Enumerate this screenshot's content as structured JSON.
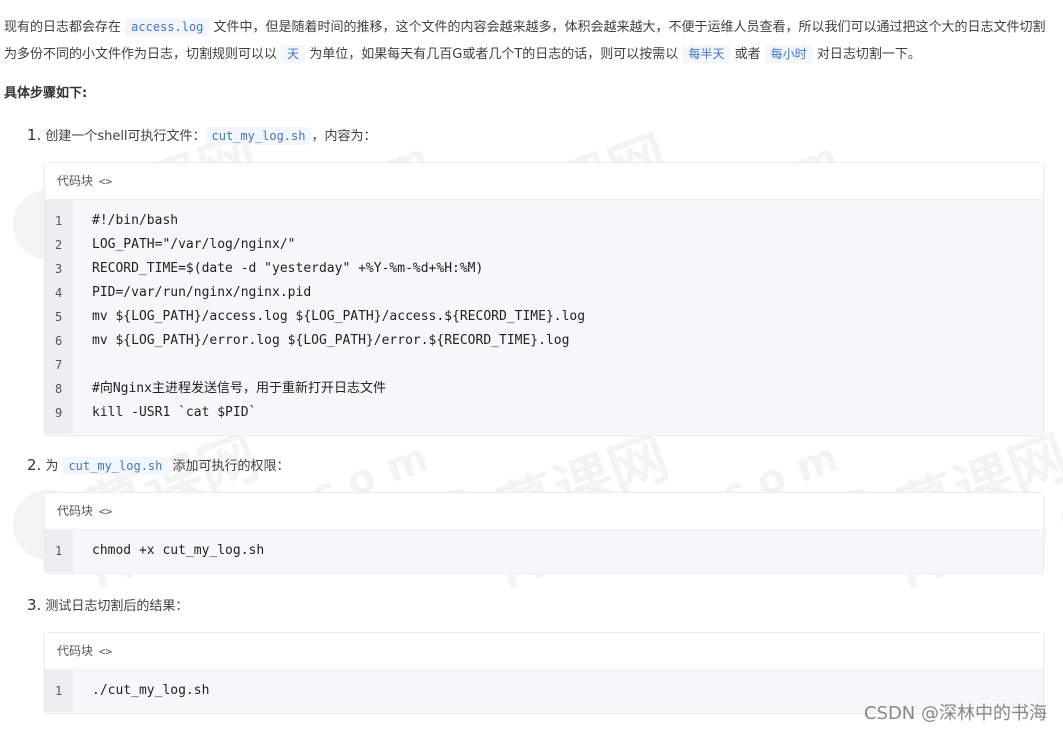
{
  "intro": {
    "seg1": "现有的日志都会存在 ",
    "code1": "access.log",
    "seg2": " 文件中，但是随着时间的推移，这个文件的内容会越来越多，体积会越来越大，不便于运维人员查看，所以我们可以通过把这个大的日志文件切割为多份不同的小文件作为日志，切割规则可以以 ",
    "code2": "天",
    "seg3": " 为单位，如果每天有几百G或者几个T的日志的话，则可以按需以 ",
    "code3": "每半天",
    "seg4": " 或者 ",
    "code4": "每小时",
    "seg5": " 对日志切割一下。"
  },
  "steps_heading": "具体步骤如下:",
  "step1": {
    "num": "1.",
    "text_before": "创建一个shell可执行文件：",
    "code": "cut_my_log.sh",
    "text_after": "，内容为："
  },
  "step2": {
    "num": "2.",
    "text_before": "为 ",
    "code": "cut_my_log.sh",
    "text_after": " 添加可执行的权限："
  },
  "step3": {
    "num": "3.",
    "text": "测试日志切割后的结果："
  },
  "code_header": {
    "label": "代码块",
    "tag": "<>"
  },
  "code_block_1": {
    "line_numbers": [
      "1",
      "2",
      "3",
      "4",
      "5",
      "6",
      "7",
      "8",
      "9"
    ],
    "lines": [
      "#!/bin/bash",
      "LOG_PATH=\"/var/log/nginx/\"",
      "RECORD_TIME=$(date -d \"yesterday\" +%Y-%m-%d+%H:%M)",
      "PID=/var/run/nginx/nginx.pid",
      "mv ${LOG_PATH}/access.log ${LOG_PATH}/access.${RECORD_TIME}.log",
      "mv ${LOG_PATH}/error.log ${LOG_PATH}/error.${RECORD_TIME}.log",
      "",
      "#向Nginx主进程发送信号，用于重新打开日志文件",
      "kill -USR1 `cat $PID`"
    ]
  },
  "code_block_2": {
    "line_numbers": [
      "1"
    ],
    "lines": [
      "chmod +x cut_my_log.sh"
    ]
  },
  "code_block_3": {
    "line_numbers": [
      "1"
    ],
    "lines": [
      "./cut_my_log.sh"
    ]
  },
  "watermark": {
    "brand": "慕课网",
    "domain": "imooc.com"
  },
  "footer_credit": "CSDN @深林中的书海"
}
